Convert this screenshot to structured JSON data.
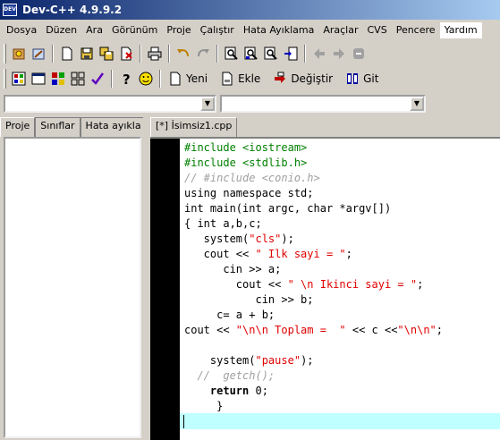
{
  "window": {
    "title": "Dev-C++ 4.9.9.2",
    "app_icon_text": "DEV"
  },
  "menu": [
    "Dosya",
    "Düzen",
    "Ara",
    "Görünüm",
    "Proje",
    "Çalıştır",
    "Hata Ayıklama",
    "Araçlar",
    "CVS",
    "Pencere",
    "Yardım"
  ],
  "toolbar_buttons": {
    "new": "Yeni",
    "add": "Ekle",
    "replace": "Değiştir",
    "goto": "Git"
  },
  "left_tabs": [
    "Proje",
    "Sınıflar",
    "Hata ayıkla"
  ],
  "editor_tab": "[*] İsimsiz1.cpp",
  "code_lines": [
    [
      {
        "t": "#include <iostream>",
        "c": "pre"
      }
    ],
    [
      {
        "t": "#include <stdlib.h>",
        "c": "pre"
      }
    ],
    [
      {
        "t": "// #include <conio.h>",
        "c": "com"
      }
    ],
    [
      {
        "t": "using namespace std;",
        "c": "sym"
      }
    ],
    [
      {
        "t": "int main(int argc, char *argv[])",
        "c": "sym"
      }
    ],
    [
      {
        "t": "{ int a,b,c;",
        "c": "sym"
      }
    ],
    [
      {
        "t": "   system(",
        "c": "sym"
      },
      {
        "t": "\"cls\"",
        "c": "str"
      },
      {
        "t": ");",
        "c": "sym"
      }
    ],
    [
      {
        "t": "   cout << ",
        "c": "sym"
      },
      {
        "t": "\" Ilk sayi = \"",
        "c": "str"
      },
      {
        "t": ";",
        "c": "sym"
      }
    ],
    [
      {
        "t": "      cin >> a;",
        "c": "sym"
      }
    ],
    [
      {
        "t": "        cout << ",
        "c": "sym"
      },
      {
        "t": "\" \\n Ikinci sayi = \"",
        "c": "str"
      },
      {
        "t": ";",
        "c": "sym"
      }
    ],
    [
      {
        "t": "           cin >> b;",
        "c": "sym"
      }
    ],
    [
      {
        "t": "     c= a + b;",
        "c": "sym"
      }
    ],
    [
      {
        "t": "cout << ",
        "c": "sym"
      },
      {
        "t": "\"\\n\\n Toplam =  \"",
        "c": "str"
      },
      {
        "t": " << c <<",
        "c": "sym"
      },
      {
        "t": "\"\\n\\n\"",
        "c": "str"
      },
      {
        "t": ";",
        "c": "sym"
      }
    ],
    [
      {
        "t": "",
        "c": "sym"
      }
    ],
    [
      {
        "t": "    system(",
        "c": "sym"
      },
      {
        "t": "\"pause\"",
        "c": "str"
      },
      {
        "t": ");",
        "c": "sym"
      }
    ],
    [
      {
        "t": "  //  getch();",
        "c": "com"
      }
    ],
    [
      {
        "t": "    ",
        "c": "sym"
      },
      {
        "t": "return",
        "c": "kw"
      },
      {
        "t": " 0;",
        "c": "sym"
      }
    ],
    [
      {
        "t": "     }",
        "c": "sym"
      }
    ]
  ]
}
